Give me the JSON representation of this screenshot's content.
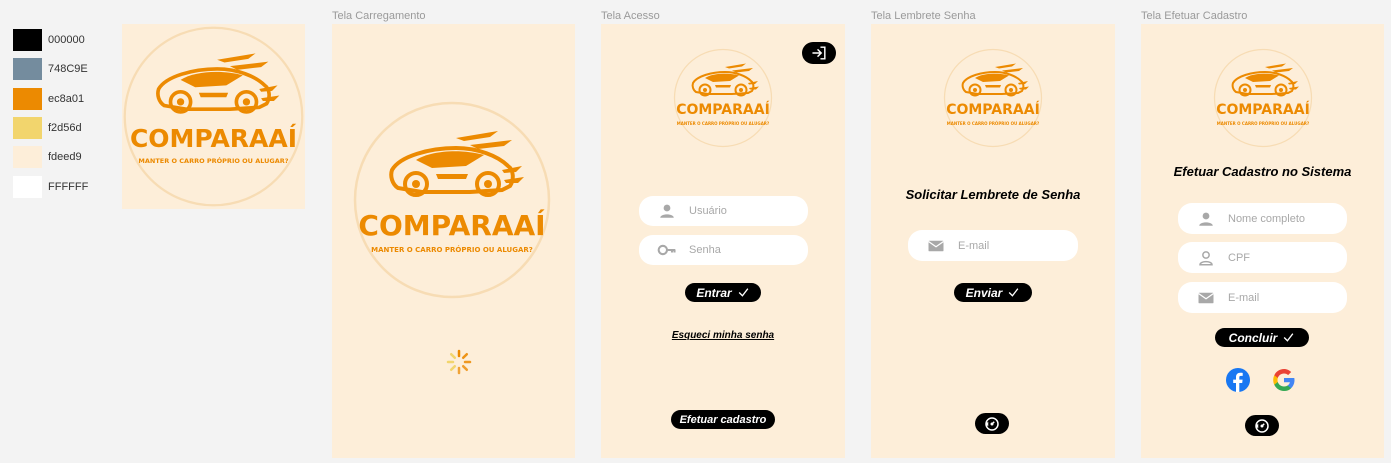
{
  "palette": [
    {
      "label": "000000",
      "color": "#000000"
    },
    {
      "label": "748C9E",
      "color": "#748C9E"
    },
    {
      "label": "ec8a01",
      "color": "#ec8a01"
    },
    {
      "label": "f2d56d",
      "color": "#f2d56d"
    },
    {
      "label": "fdeed9",
      "color": "#fdeed9"
    },
    {
      "label": "FFFFFF",
      "color": "#FFFFFF"
    }
  ],
  "brand": {
    "name": "COMPARAAÍ",
    "tagline": "MANTER O CARRO PRÓPRIO OU ALUGAR?",
    "accent": "#ec8a01",
    "background": "#fdeed9"
  },
  "frames": {
    "loading": {
      "title": "Tela Carregamento",
      "spinner_icon": "loading-spinner-icon"
    },
    "access": {
      "title": "Tela Acesso",
      "logout_icon": "logout-icon",
      "username_placeholder": "Usuário",
      "password_placeholder": "Senha",
      "login_button": "Entrar",
      "forgot_link": "Esqueci minha senha",
      "signup_button": "Efetuar cadastro"
    },
    "reminder": {
      "title": "Tela Lembrete Senha",
      "heading": "Solicitar Lembrete de Senha",
      "email_placeholder": "E-mail",
      "send_button": "Enviar",
      "back_icon": "back-icon"
    },
    "signup": {
      "title": "Tela Efetuar Cadastro",
      "heading": "Efetuar Cadastro no Sistema",
      "fullname_placeholder": "Nome completo",
      "cpf_placeholder": "CPF",
      "email_placeholder": "E-mail",
      "submit_button": "Concluir",
      "facebook_icon": "facebook-icon",
      "google_icon": "google-icon",
      "back_icon": "back-icon"
    }
  }
}
